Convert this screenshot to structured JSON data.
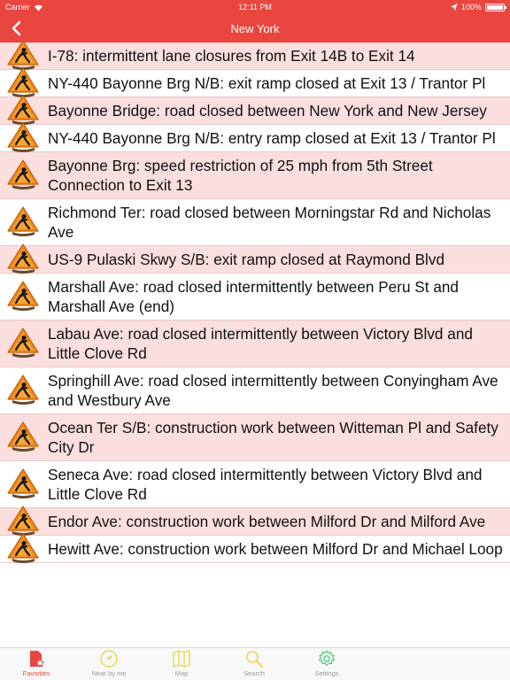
{
  "status": {
    "carrier": "Carrier",
    "time": "12:11 PM",
    "battery": "100%",
    "battery_level": 1.0
  },
  "nav": {
    "title": "New York"
  },
  "items": [
    {
      "text": "I-78: intermittent lane closures from Exit 14B to Exit 14"
    },
    {
      "text": "NY-440 Bayonne Brg N/B: exit ramp closed at Exit 13 / Trantor Pl"
    },
    {
      "text": "Bayonne Bridge: road closed between New York and New Jersey"
    },
    {
      "text": "NY-440 Bayonne Brg N/B: entry ramp closed at Exit 13 / Trantor Pl"
    },
    {
      "text": "Bayonne Brg: speed restriction of 25 mph from 5th Street Connection to Exit 13"
    },
    {
      "text": "Richmond Ter: road closed between Morningstar Rd and Nicholas Ave"
    },
    {
      "text": "US-9 Pulaski Skwy S/B: exit ramp closed at Raymond Blvd"
    },
    {
      "text": "Marshall Ave: road closed intermittently between Peru St and Marshall Ave (end)"
    },
    {
      "text": "Labau Ave: road closed intermittently between Victory Blvd and Little Clove Rd"
    },
    {
      "text": "Springhill Ave: road closed intermittently between Conyingham Ave and Westbury Ave"
    },
    {
      "text": "Ocean Ter S/B: construction work between Witteman Pl and Safety City Dr"
    },
    {
      "text": "Seneca Ave: road closed intermittently between Victory Blvd and Little Clove Rd"
    },
    {
      "text": "Endor Ave: construction work between Milford Dr and Milford Ave"
    },
    {
      "text": "Hewitt Ave: construction work between Milford Dr and Michael Loop"
    }
  ],
  "tabs": [
    {
      "label": "Favorites",
      "icon": "favorites-icon"
    },
    {
      "label": "Near by me",
      "icon": "near-by-me-icon"
    },
    {
      "label": "Map",
      "icon": "map-icon"
    },
    {
      "label": "Search",
      "icon": "search-icon"
    },
    {
      "label": "Settings",
      "icon": "settings-icon"
    }
  ],
  "colors": {
    "accent": "#e8463f",
    "row_alt": "#fbdede",
    "tab_inactive": "#e8d84a",
    "tab_settings": "#5cc47a"
  }
}
